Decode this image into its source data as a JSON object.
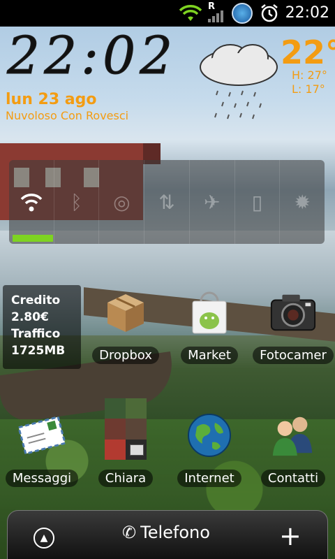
{
  "status_bar": {
    "time": "22:02",
    "icons": [
      "wifi-icon",
      "signal-roaming-icon",
      "app-notification-icon",
      "alarm-icon"
    ],
    "roaming_label": "R"
  },
  "clock_widget": {
    "time": "22:02",
    "date": "lun 23 ago",
    "condition": "Nuvoloso Con Rovesci"
  },
  "weather_widget": {
    "temperature": "22°",
    "high": "H:  27°",
    "low": "L:  17°",
    "icon": "rain-cloud-icon"
  },
  "power_control": {
    "toggles": [
      {
        "name": "wifi",
        "icon": "wifi-icon",
        "on": true
      },
      {
        "name": "bluetooth",
        "icon": "bluetooth-icon",
        "on": false
      },
      {
        "name": "gps",
        "icon": "gps-icon",
        "on": false
      },
      {
        "name": "sync",
        "icon": "sync-icon",
        "on": false
      },
      {
        "name": "airplane",
        "icon": "airplane-icon",
        "on": false
      },
      {
        "name": "screen-rotation",
        "icon": "rotation-icon",
        "on": false
      },
      {
        "name": "brightness",
        "icon": "brightness-icon",
        "on": false
      }
    ]
  },
  "credit_widget": {
    "line1": "Credito",
    "line2": "2.80€",
    "line3": "Traffico",
    "line4": "1725MB"
  },
  "apps": {
    "dropbox": "Dropbox",
    "market": "Market",
    "camera": "Fotocamer",
    "messages": "Messaggi",
    "chiara": "Chiara",
    "internet": "Internet",
    "contacts": "Contatti"
  },
  "dock": {
    "phone_label": "Telefono"
  },
  "colors": {
    "accent": "#f39c12",
    "toggle_on": "#7ed321"
  }
}
